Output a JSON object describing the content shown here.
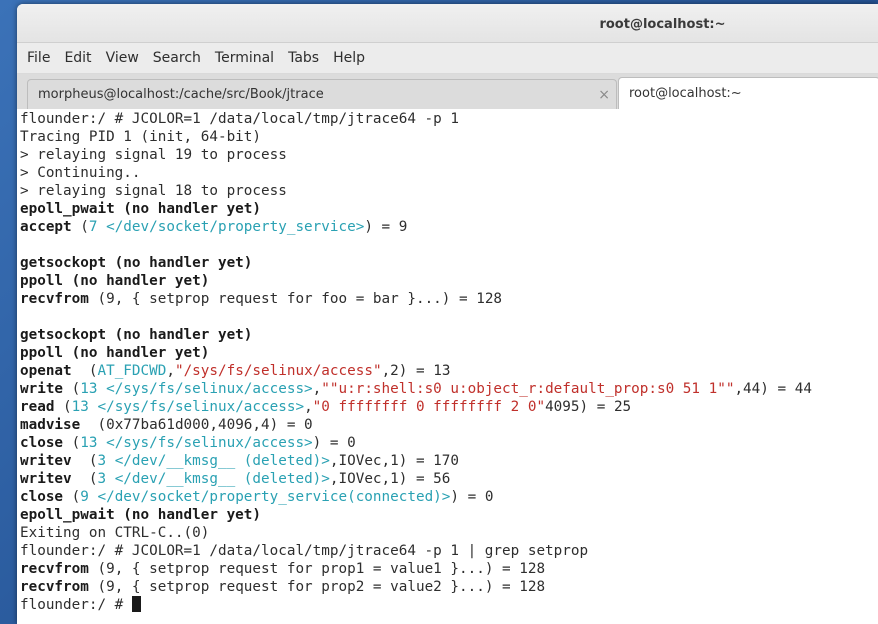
{
  "window": {
    "title": "root@localhost:~"
  },
  "menu": [
    "File",
    "Edit",
    "View",
    "Search",
    "Terminal",
    "Tabs",
    "Help"
  ],
  "tabs": [
    {
      "label": "morpheus@localhost:/cache/src/Book/jtrace",
      "close": "×"
    },
    {
      "label": "root@localhost:~"
    }
  ],
  "terminal": {
    "lines": [
      "flounder:/ # JCOLOR=1 /data/local/tmp/jtrace64 -p 1",
      "Tracing PID 1 (init, 64-bit)",
      "> relaying signal 19 to process",
      "> Continuing..",
      "> relaying signal 18 to process",
      "epoll_pwait (no handler yet)",
      {
        "b": "accept",
        "t1": " (",
        "c": "7 </dev/socket/property_service>",
        "t2": ") = 9"
      },
      "",
      "getsockopt (no handler yet)",
      "ppoll (no handler yet)",
      {
        "b": "recvfrom",
        "t1": " (9, { setprop request for foo = bar }...) = 128"
      },
      "",
      "getsockopt (no handler yet)",
      "ppoll (no handler yet)",
      {
        "b": "openat",
        "t1": "  (",
        "c": "AT_FDCWD",
        "t2": ",",
        "r": "\"/sys/fs/selinux/access\"",
        "t3": ",2) = 13"
      },
      {
        "b": "write",
        "t1": " (",
        "c": "13 </sys/fs/selinux/access>",
        "t2": ",",
        "r": "\"\"u:r:shell:s0 u:object_r:default_prop:s0 51 1\"\"",
        "t3": ",44) = 44"
      },
      {
        "b": "read",
        "t1": " (",
        "c": "13 </sys/fs/selinux/access>",
        "t2": ",",
        "r": "\"0 ffffffff 0 ffffffff 2 0\"",
        "t3": "4095) = 25"
      },
      {
        "b": "madvise",
        "t1": "  (0x77ba61d000,4096,4) = 0"
      },
      {
        "b": "close",
        "t1": " (",
        "c": "13 </sys/fs/selinux/access>",
        "t2": ") = 0"
      },
      {
        "b": "writev",
        "t1": "  (",
        "c": "3 </dev/__kmsg__ (deleted)>",
        "t2": ",IOVec,1) = 170"
      },
      {
        "b": "writev",
        "t1": "  (",
        "c": "3 </dev/__kmsg__ (deleted)>",
        "t2": ",IOVec,1) = 56"
      },
      {
        "b": "close",
        "t1": " (",
        "c": "9 </dev/socket/property_service(connected)>",
        "t2": ") = 0"
      },
      "epoll_pwait (no handler yet)",
      "Exiting on CTRL-C..(0)",
      "flounder:/ # JCOLOR=1 /data/local/tmp/jtrace64 -p 1 | grep setprop",
      {
        "b": "recvfrom",
        "t1": " (9, { setprop request for prop1 = value1 }...) = 128"
      },
      {
        "b": "recvfrom",
        "t1": " (9, { setprop request for prop2 = value2 }...) = 128"
      },
      "flounder:/ # "
    ],
    "bold_lines": [
      5,
      8,
      9,
      12,
      13,
      22
    ]
  }
}
